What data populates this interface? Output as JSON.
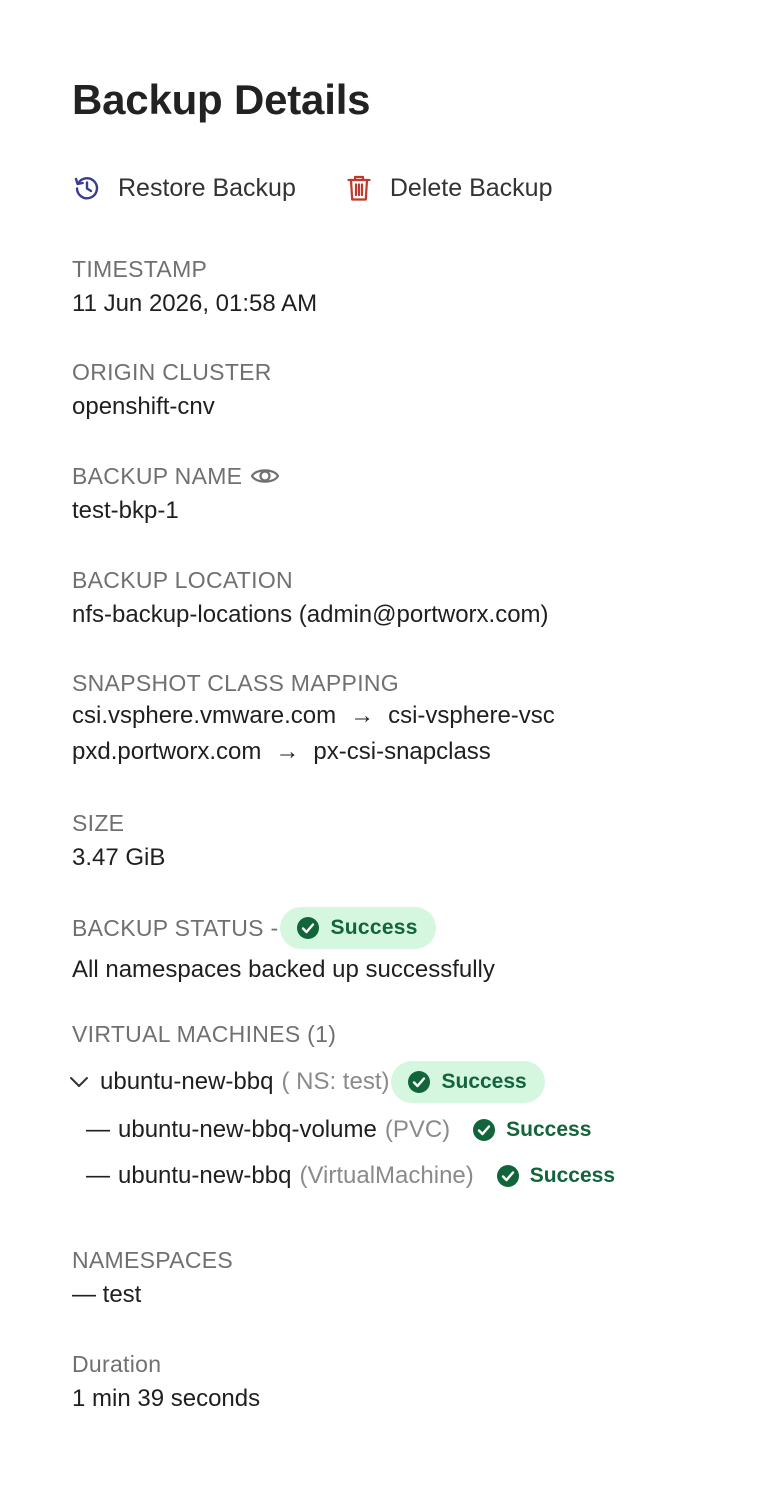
{
  "panel": {
    "title": "Backup Details",
    "actions": {
      "restore_label": "Restore Backup",
      "delete_label": "Delete Backup"
    }
  },
  "fields": {
    "timestamp": {
      "label": "TIMESTAMP",
      "value": "11 Jun 2026, 01:58 AM"
    },
    "origin_cluster": {
      "label": "ORIGIN CLUSTER",
      "value": "openshift-cnv"
    },
    "backup_name": {
      "label": "BACKUP NAME",
      "value": "test-bkp-1"
    },
    "backup_location": {
      "label": "BACKUP LOCATION",
      "value": "nfs-backup-locations (admin@portworx.com)"
    },
    "snapshot_class_mapping": {
      "label": "SNAPSHOT CLASS MAPPING",
      "rows": [
        {
          "from": "csi.vsphere.vmware.com",
          "arrow": "→",
          "to": "csi-vsphere-vsc"
        },
        {
          "from": "pxd.portworx.com",
          "arrow": "→",
          "to": "px-csi-snapclass"
        }
      ]
    },
    "size": {
      "label": "SIZE",
      "value": "3.47 GiB"
    },
    "backup_status": {
      "label": "BACKUP STATUS -",
      "status": "Success",
      "message": "All namespaces backed up successfully"
    },
    "virtual_machines": {
      "label": "VIRTUAL MACHINES (1)",
      "vm": {
        "name": "ubuntu-new-bbq",
        "ns": "( NS: test)",
        "status": "Success",
        "resources": [
          {
            "dash": "—",
            "name": "ubuntu-new-bbq-volume",
            "kind": "(PVC)",
            "status": "Success"
          },
          {
            "dash": "—",
            "name": "ubuntu-new-bbq",
            "kind": "(VirtualMachine)",
            "status": "Success"
          }
        ]
      }
    },
    "namespaces": {
      "label": "NAMESPACES",
      "value": "— test"
    },
    "duration": {
      "label": "Duration",
      "value": "1 min 39 seconds"
    }
  },
  "colors": {
    "success_text": "#12653a",
    "success_bg": "#d5f6df",
    "delete_icon": "#c0392b",
    "restore_icon": "#3a3d8f"
  },
  "icons": {
    "restore": "history-icon",
    "delete": "trash-icon",
    "eye": "eye-icon",
    "check": "check-circle-icon",
    "chevron": "chevron-down-icon"
  }
}
